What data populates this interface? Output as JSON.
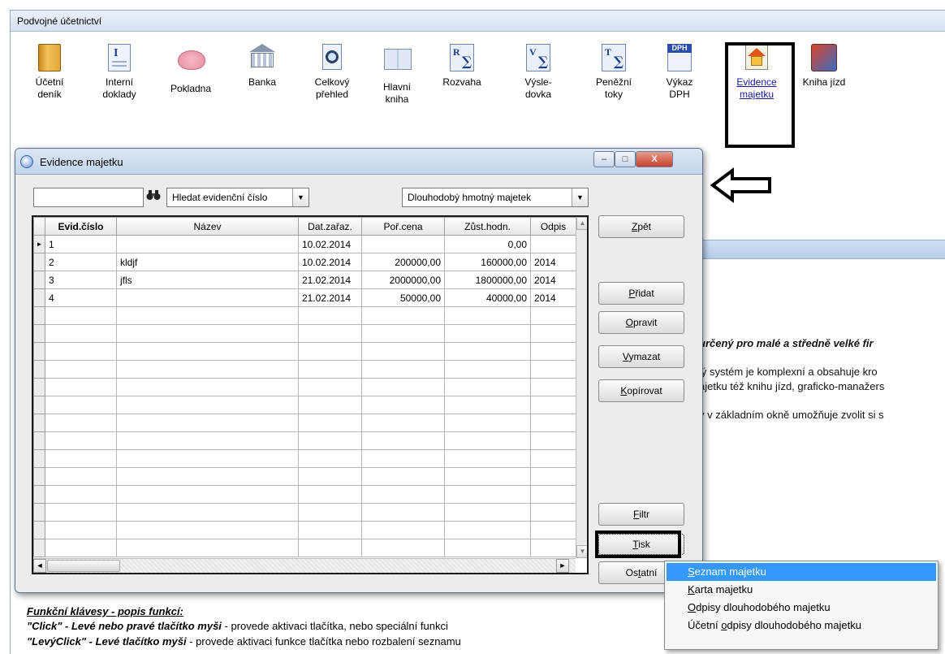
{
  "app": {
    "title": "Podvojné účetnictví",
    "toolbar": [
      {
        "id": "ucetni-denik",
        "label": "Účetní\ndeník",
        "icon": "ledger-book-icon"
      },
      {
        "id": "interni-doklady",
        "label": "Interní\ndoklady",
        "icon": "internal-document-icon"
      },
      {
        "id": "pokladna",
        "label": "Pokladna",
        "icon": "piggy-bank-icon"
      },
      {
        "id": "banka",
        "label": "Banka",
        "icon": "bank-icon"
      },
      {
        "id": "celkovy-prehled",
        "label": "Celkový\npřehled",
        "icon": "overview-magnifier-icon"
      },
      {
        "id": "hlavni-kniha",
        "label": "Hlavní\nkniha",
        "icon": "open-book-icon"
      },
      {
        "id": "rozvaha",
        "label": "Rozvaha",
        "icon": "balance-sheet-icon"
      },
      {
        "id": "vysledovka",
        "label": "Výsle-\ndovka",
        "icon": "profit-loss-icon"
      },
      {
        "id": "penezni-toky",
        "label": "Peněžní\ntoky",
        "icon": "cash-flow-icon"
      },
      {
        "id": "vykaz-dph",
        "label": "Výkaz\nDPH",
        "icon": "vat-report-icon"
      },
      {
        "id": "evidence-majetku",
        "label": "Evidence\nmajetku",
        "icon": "asset-register-house-icon"
      },
      {
        "id": "kniha-jizd",
        "label": "Kniha jízd",
        "icon": "logbook-road-icon"
      }
    ],
    "icon_letters": {
      "rozvaha": "R",
      "vysledovka": "V",
      "penezni_toky": "T",
      "sigma": "∑",
      "dph": "DPH",
      "interni": "I"
    },
    "background_text": {
      "line1": "určený pro malé a středně velké fir",
      "line2": "lý systém je komplexní a obsahuje kro",
      "line3": "ajetku též knihu jízd, graficko-manažers",
      "line4": "y v základním okně umožňuje zvolit si s"
    },
    "help": {
      "heading": "Funkční klávesy - popis funkcí:",
      "row1_key": "\"Click\" - Levé nebo pravé tlačítko myši",
      "row1_text": " - provede aktivaci tlačítka, nebo speciální funkci",
      "row2_key": "\"LevýClick\" - Levé tlačítko myši",
      "row2_text": " - provede aktivaci funkce tlačítka nebo rozbalení seznamu"
    }
  },
  "dialog": {
    "title": "Evidence majetku",
    "window_buttons": {
      "minimize": "–",
      "maximize": "□",
      "close": "X"
    },
    "search_value": "",
    "search_icon": "binoculars-icon",
    "search_mode": "Hledat evidenční číslo",
    "category": "Dlouhodobý hmotný majetek",
    "dropdown_arrow": "▼",
    "grid": {
      "columns": [
        "Evid.číslo",
        "Název",
        "Dat.zařaz.",
        "Poř.cena",
        "Zůst.hodn.",
        "Odpis"
      ],
      "rows": [
        {
          "evid": "1",
          "nazev": "",
          "datum": "10.02.2014",
          "cena": "",
          "zust": "0,00",
          "odpis": ""
        },
        {
          "evid": "2",
          "nazev": "kldjf",
          "datum": "10.02.2014",
          "cena": "200000,00",
          "zust": "160000,00",
          "odpis": "2014"
        },
        {
          "evid": "3",
          "nazev": "jfls",
          "datum": "21.02.2014",
          "cena": "2000000,00",
          "zust": "1800000,00",
          "odpis": "2014"
        },
        {
          "evid": "4",
          "nazev": "",
          "datum": "21.02.2014",
          "cena": "50000,00",
          "zust": "40000,00",
          "odpis": "2014"
        }
      ],
      "current_row_marker": "►",
      "scroll_up": "▲",
      "scroll_down": "▼",
      "scroll_left": "◄",
      "scroll_right": "►"
    },
    "buttons": {
      "zpet": {
        "u": "Z",
        "rest": "pět"
      },
      "pridat": {
        "u": "P",
        "rest": "řidat"
      },
      "opravit": {
        "u": "O",
        "rest": "pravit"
      },
      "vymazat": {
        "u": "V",
        "rest": "ymazat"
      },
      "kopirovat": {
        "u": "K",
        "rest": "opírovat"
      },
      "filtr": {
        "pre": "",
        "u": "F",
        "rest": "iltr"
      },
      "tisk": {
        "u": "T",
        "rest": "isk"
      },
      "ostatni": {
        "pre": "Os",
        "u": "t",
        "rest": "atní"
      }
    }
  },
  "print_menu": {
    "items": [
      {
        "pre": "",
        "u": "S",
        "rest": "eznam majetku",
        "selected": true
      },
      {
        "pre": "",
        "u": "K",
        "rest": "arta majetku",
        "selected": false
      },
      {
        "pre": "",
        "u": "O",
        "rest": "dpisy dlouhodobého majetku",
        "selected": false
      },
      {
        "pre": "Účetní ",
        "u": "o",
        "rest": "dpisy dlouhodobého majetku",
        "selected": false
      }
    ]
  },
  "colors": {
    "menu_highlight": "#3399ff",
    "title_bar": "#c3d5ec",
    "close_button": "#c7422b"
  }
}
